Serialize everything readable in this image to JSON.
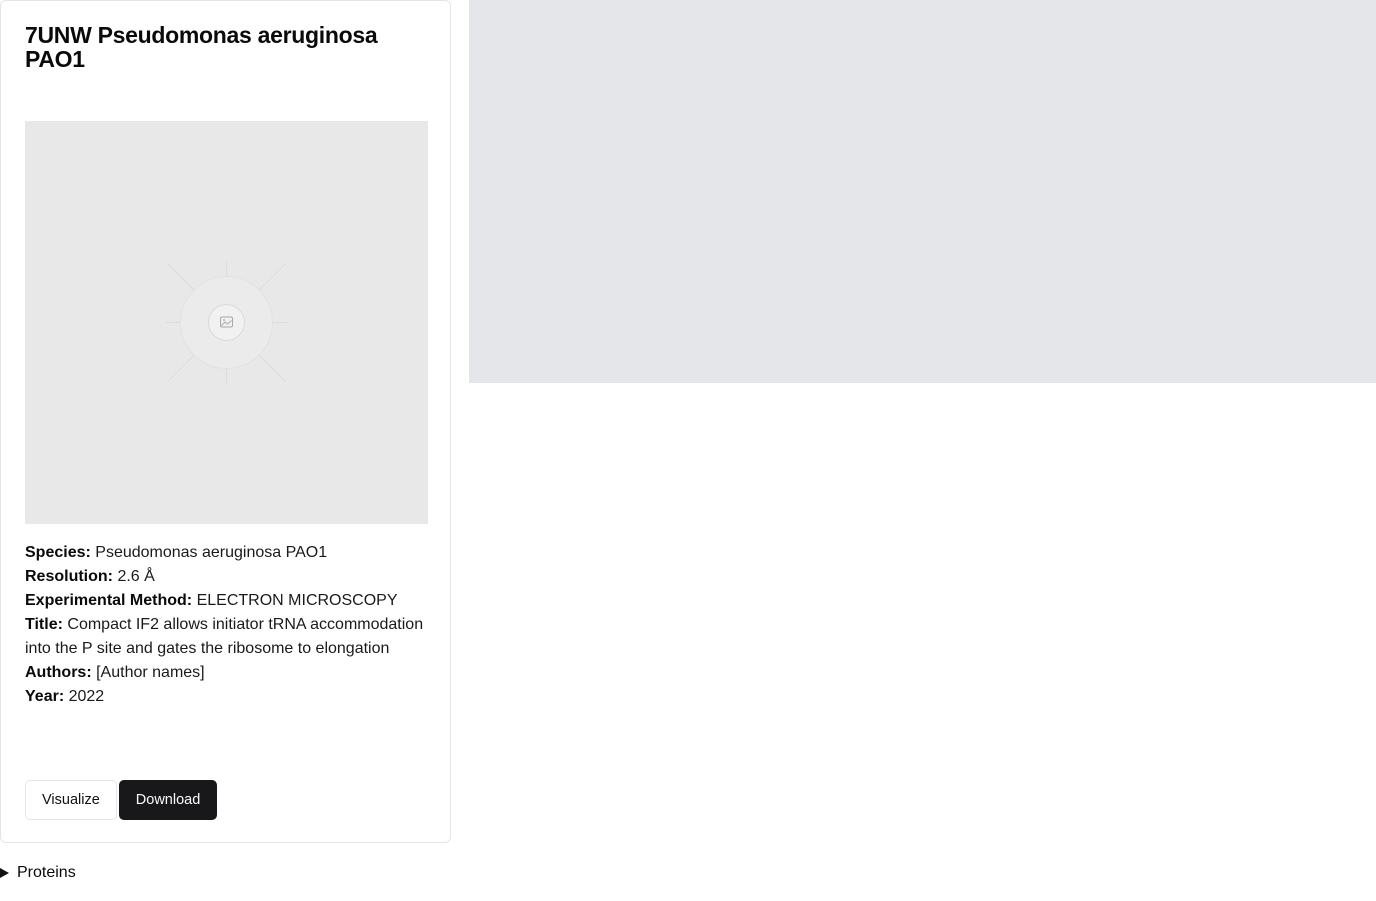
{
  "card": {
    "title": "7UNW Pseudomonas aeruginosa PAO1",
    "image_icon": "image-placeholder-icon",
    "fields": {
      "species": {
        "label": "Species:",
        "value": "Pseudomonas aeruginosa PAO1"
      },
      "resolution": {
        "label": "Resolution:",
        "value": "2.6 Å"
      },
      "method": {
        "label": "Experimental Method:",
        "value": "ELECTRON MICROSCOPY"
      },
      "title": {
        "label": "Title:",
        "value": "Compact IF2 allows initiator tRNA accommodation into the P site and gates the ribosome to elongation"
      },
      "authors": {
        "label": "Authors:",
        "value": "[Author names]"
      },
      "year": {
        "label": "Year:",
        "value": "2022"
      }
    },
    "buttons": {
      "visualize": "Visualize",
      "download": "Download"
    }
  },
  "proteins": {
    "label": "Proteins",
    "icon": "disclosure-triangle-icon"
  },
  "colors": {
    "viewer_bg": "#e5e6e9",
    "thumb_bg": "#e8e8e8",
    "primary_button": "#18181b"
  }
}
